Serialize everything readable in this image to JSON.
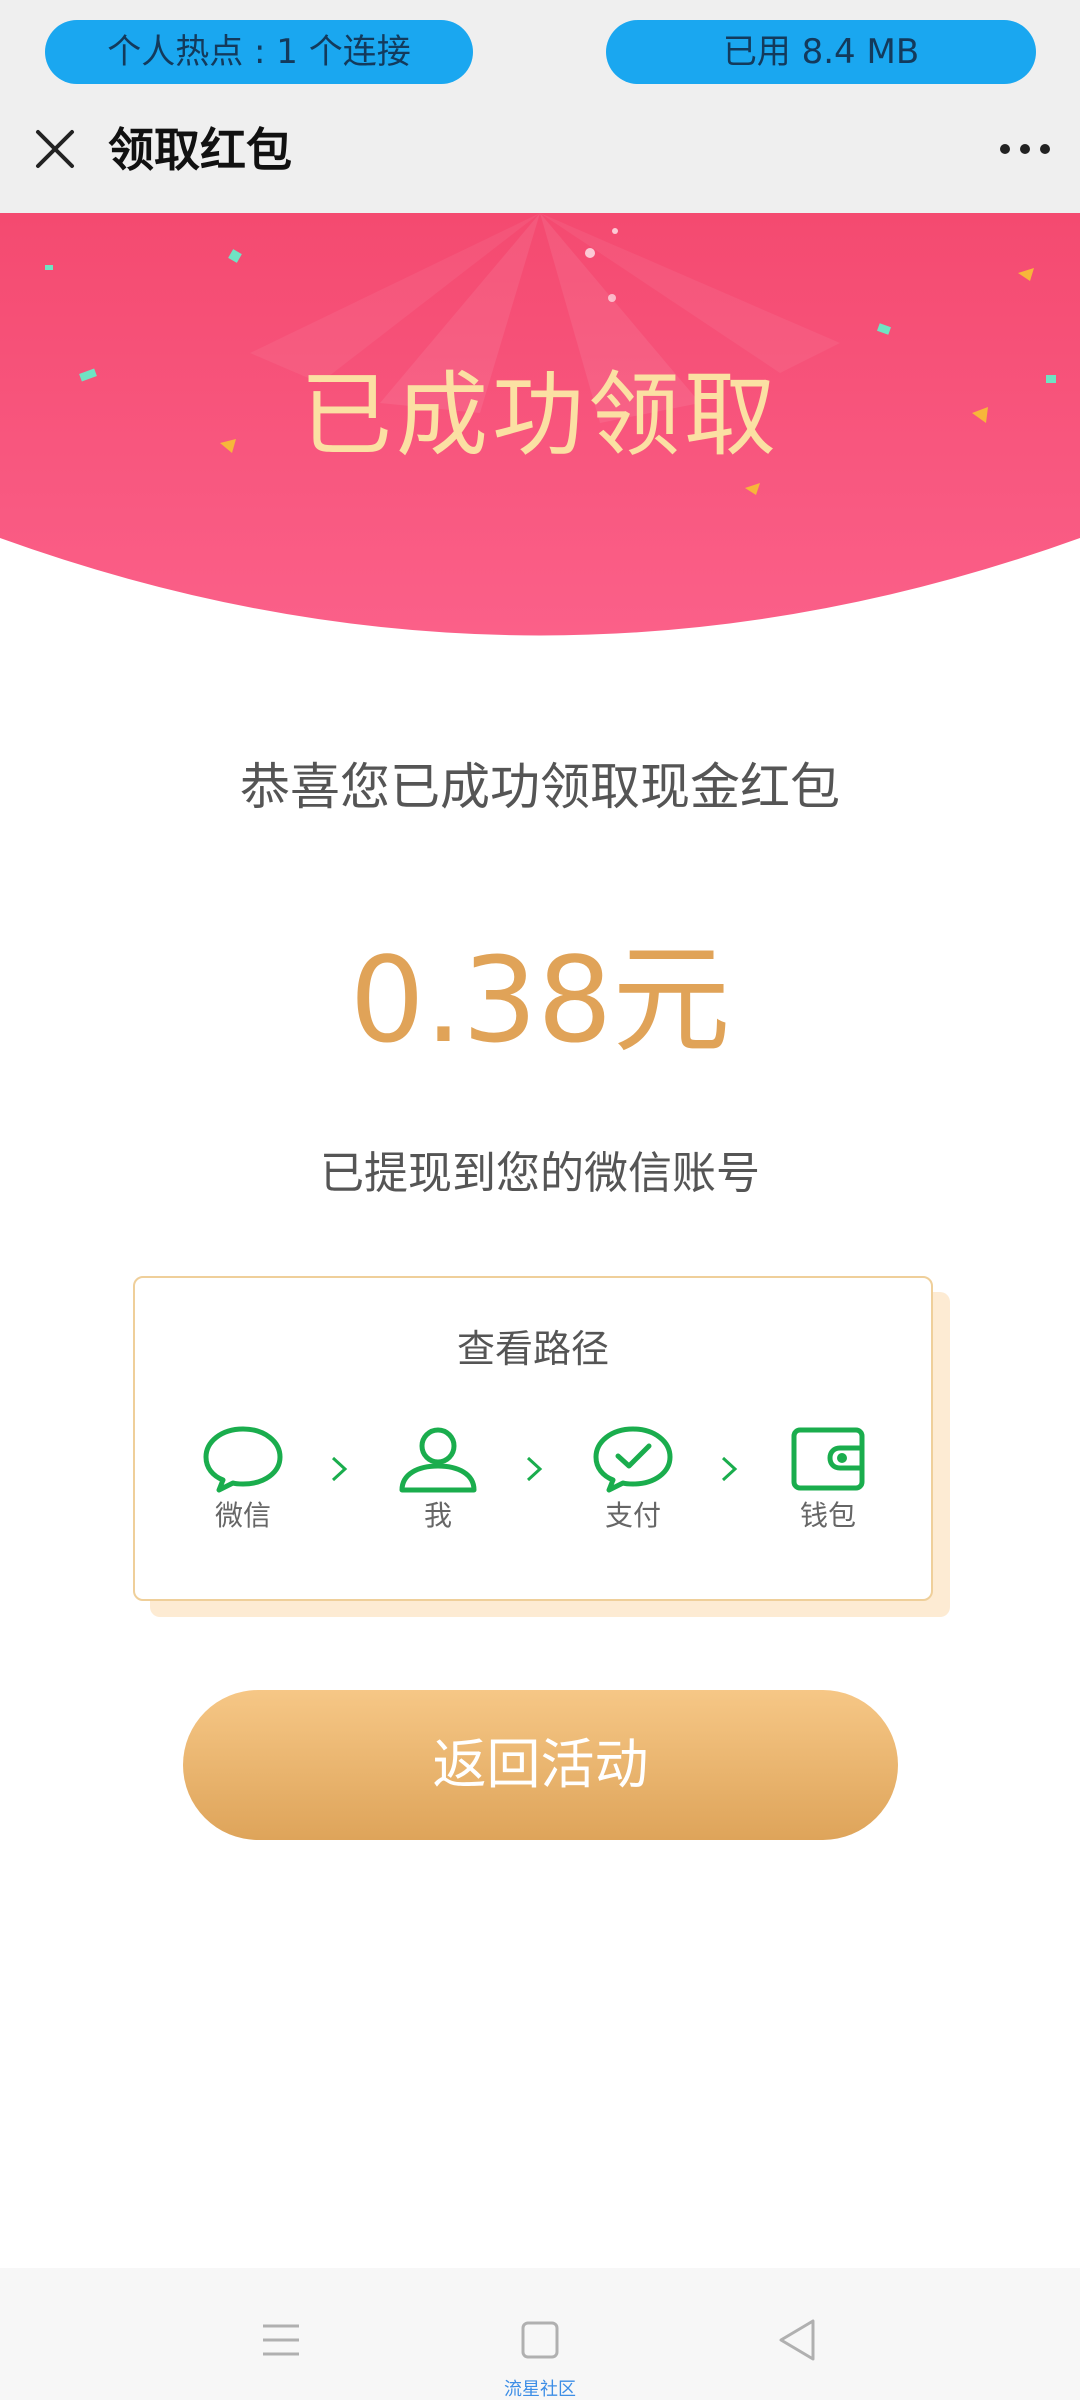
{
  "status_bar": {
    "hotspot_text": "个人热点 : 1 个连接",
    "data_used_text": "已用 8.4 MB"
  },
  "header": {
    "title": "领取红包",
    "close_icon": "close-icon",
    "more_icon": "more-dots-icon"
  },
  "banner": {
    "title": "已成功领取"
  },
  "content": {
    "congrats_text": "恭喜您已成功领取现金红包",
    "amount_text": "0.38元",
    "withdrawn_text": "已提现到您的微信账号"
  },
  "path_card": {
    "title": "查看路径",
    "steps": [
      {
        "label": "微信",
        "icon": "chat-bubble-icon"
      },
      {
        "label": "我",
        "icon": "user-icon"
      },
      {
        "label": "支付",
        "icon": "pay-check-icon"
      },
      {
        "label": "钱包",
        "icon": "wallet-icon"
      }
    ]
  },
  "return_button": {
    "label": "返回活动"
  },
  "bottom_nav": {
    "items": [
      "menu-icon",
      "home-square-icon",
      "back-triangle-icon"
    ],
    "watermark": "流星社区"
  },
  "colors": {
    "banner_red": "#f65b7e",
    "banner_title": "#fbe0a3",
    "amount": "#e0a358",
    "wechat_green": "#1aad4d",
    "button_top": "#f6c786",
    "button_bottom": "#dea45a",
    "pill_blue": "#1aa7f0"
  }
}
